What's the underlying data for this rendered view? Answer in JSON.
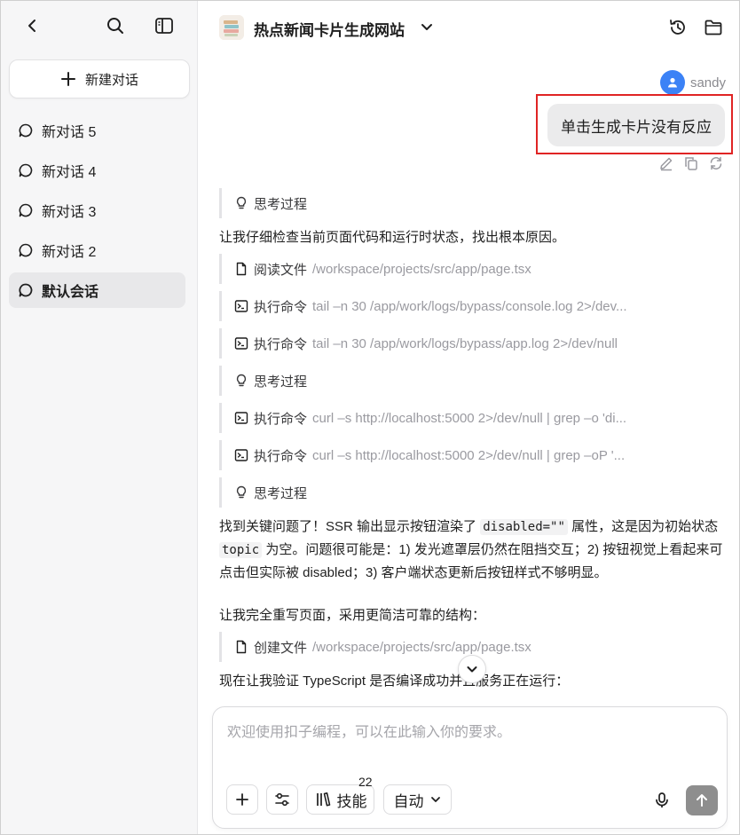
{
  "sidebar": {
    "new_chat_label": "新建对话",
    "conversations": [
      {
        "label": "新对话 5"
      },
      {
        "label": "新对话 4"
      },
      {
        "label": "新对话 3"
      },
      {
        "label": "新对话 2"
      },
      {
        "label": "默认会话"
      }
    ],
    "active_index": 4
  },
  "header": {
    "project_title": "热点新闻卡片生成网站"
  },
  "user": {
    "name": "sandy",
    "message": "单击生成卡片没有反应"
  },
  "assistant": {
    "thinking_label": "思考过程",
    "intro": "让我仔细检查当前页面代码和运行时状态，找出根本原因。",
    "steps": [
      {
        "action": "阅读文件",
        "arg": "/workspace/projects/src/app/page.tsx",
        "icon": "file-icon"
      },
      {
        "action": "执行命令",
        "arg": "tail –n 30 /app/work/logs/bypass/console.log 2>/dev...",
        "icon": "terminal-icon"
      },
      {
        "action": "执行命令",
        "arg": "tail –n 30 /app/work/logs/bypass/app.log 2>/dev/null",
        "icon": "terminal-icon"
      },
      {
        "action": "执行命令",
        "arg": "curl –s http://localhost:5000 2>/dev/null | grep –o 'di...",
        "icon": "terminal-icon"
      },
      {
        "action": "执行命令",
        "arg": "curl –s http://localhost:5000 2>/dev/null | grep –oP '...",
        "icon": "terminal-icon"
      },
      {
        "action": "创建文件",
        "arg": "/workspace/projects/src/app/page.tsx",
        "icon": "file-icon"
      }
    ],
    "finding_p1": "找到关键问题了！SSR 输出显示按钮渲染了",
    "finding_code1": "disabled=\"\"",
    "finding_p2": "属性，这是因为初始状态",
    "finding_code2": "topic",
    "finding_p3": "为空。问题很可能是：1) 发光遮罩层仍然在阻挡交互；2) 按钮视觉上看起来可点击但实际被 disabled；3) 客户端状态更新后按钮样式不够明显。",
    "rewrite": "让我完全重写页面，采用更简洁可靠的结构：",
    "verify": "现在让我验证 TypeScript 是否编译成功并且服务正在运行："
  },
  "composer": {
    "placeholder": "欢迎使用扣子编程，可以在此输入你的要求。",
    "skills_label": "技能",
    "skills_count": "22",
    "mode_label": "自动"
  },
  "colors": {
    "accent": "#3b82f6",
    "highlight": "#e02424",
    "sidebar_bg": "#f6f6f7"
  }
}
